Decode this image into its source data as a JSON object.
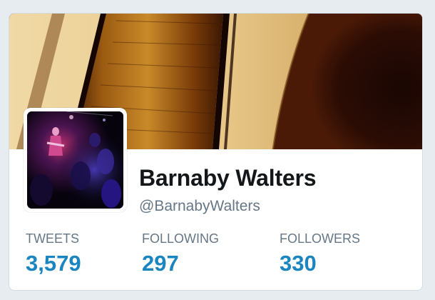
{
  "profile": {
    "name": "Barnaby Walters",
    "handle": "@BarnabyWalters"
  },
  "banner": {
    "description_icon": "banner-image",
    "colors": {
      "wood_light": "#f2d9a4",
      "wood_dark": "#6b3306",
      "soundhole": "#240b04"
    }
  },
  "avatar": {
    "icon": "avatar-image"
  },
  "stats": {
    "tweets": {
      "label": "TWEETS",
      "value": "3,579"
    },
    "following": {
      "label": "FOLLOWING",
      "value": "297"
    },
    "followers": {
      "label": "FOLLOWERS",
      "value": "330"
    }
  },
  "colors": {
    "accent": "#1b85bf",
    "muted": "#657786",
    "name": "#14171a",
    "page_background": "#e6ecf0"
  }
}
